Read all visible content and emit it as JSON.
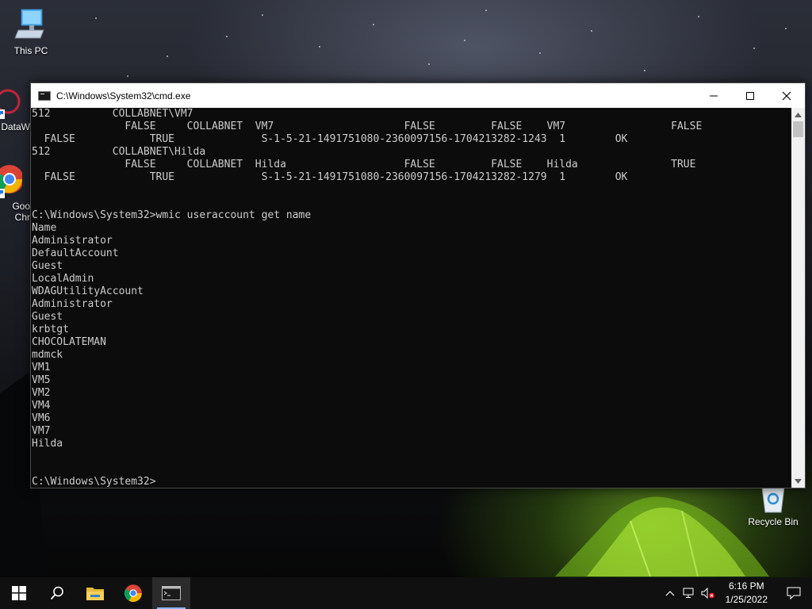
{
  "desktop": {
    "icons": [
      {
        "label": "This PC"
      },
      {
        "label": "DataW"
      },
      {
        "label": "Goo\nChr"
      },
      {
        "label": "Recycle Bin"
      }
    ]
  },
  "window": {
    "title": "C:\\Windows\\System32\\cmd.exe",
    "lines": [
      "512          COLLABNET\\VM7",
      "               FALSE     COLLABNET  VM7                     FALSE         FALSE    VM7                 FALSE",
      "  FALSE            TRUE              S-1-5-21-1491751080-2360097156-1704213282-1243  1        OK",
      "512          COLLABNET\\Hilda",
      "               FALSE     COLLABNET  Hilda                   FALSE         FALSE    Hilda               TRUE",
      "  FALSE            TRUE              S-1-5-21-1491751080-2360097156-1704213282-1279  1        OK",
      "",
      "",
      "C:\\Windows\\System32>wmic useraccount get name",
      "Name",
      "Administrator",
      "DefaultAccount",
      "Guest",
      "LocalAdmin",
      "WDAGUtilityAccount",
      "Administrator",
      "Guest",
      "krbtgt",
      "CHOCOLATEMAN",
      "mdmck",
      "VM1",
      "VM5",
      "VM2",
      "VM4",
      "VM6",
      "VM7",
      "Hilda",
      "",
      "",
      "C:\\Windows\\System32>"
    ]
  },
  "taskbar": {
    "time": "6:16 PM",
    "date": "1/25/2022"
  }
}
